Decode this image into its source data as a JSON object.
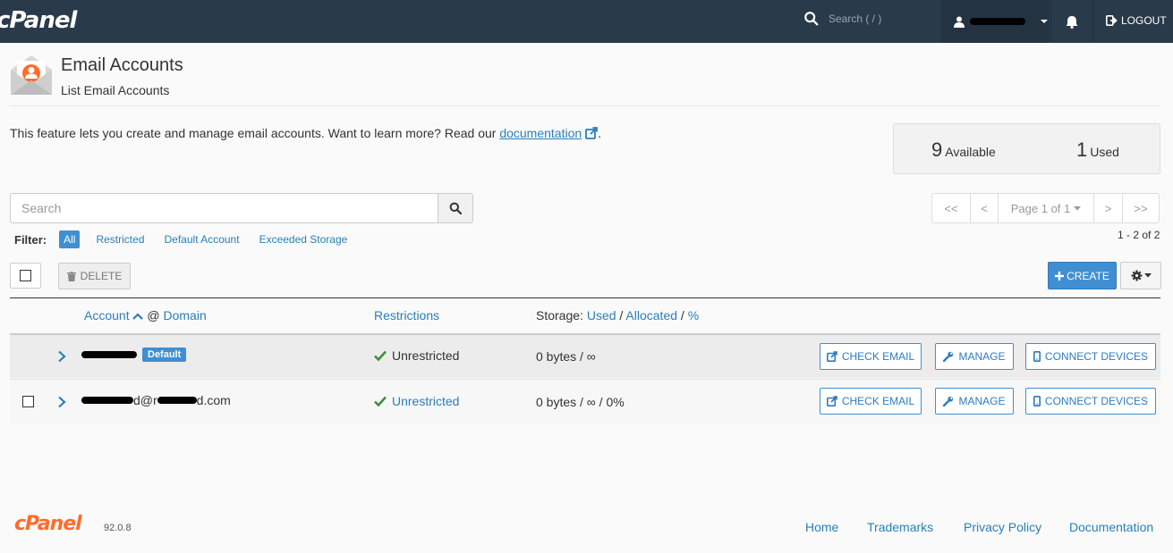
{
  "topbar": {
    "logo": "cPanel",
    "search_placeholder": "Search ( / )",
    "logout_label": "LOGOUT"
  },
  "header": {
    "title": "Email Accounts",
    "subtitle": "List Email Accounts"
  },
  "intro": {
    "text": "This feature lets you create and manage email accounts. Want to learn more? Read our ",
    "link": "documentation",
    "end": "."
  },
  "stats": {
    "available_num": "9",
    "available_label": "Available",
    "used_num": "1",
    "used_label": "Used"
  },
  "search": {
    "placeholder": "Search"
  },
  "filter": {
    "label": "Filter:",
    "items": [
      "All",
      "Restricted",
      "Default Account",
      "Exceeded Storage"
    ]
  },
  "pager": {
    "first": "<<",
    "prev": "<",
    "page": "Page 1 of 1",
    "next": ">",
    "last": ">>",
    "range": "1 - 2 of 2"
  },
  "toolbar": {
    "delete_label": "DELETE",
    "create_label": "CREATE"
  },
  "table": {
    "col_account": "Account",
    "col_at": "@",
    "col_domain": "Domain",
    "col_restrictions": "Restrictions",
    "col_storage": "Storage:",
    "col_used": "Used",
    "col_sep": "/",
    "col_allocated": "Allocated",
    "col_pct": "%",
    "rows": [
      {
        "account_suffix": "",
        "badge": "Default",
        "restriction": "Unrestricted",
        "storage": "0 bytes / ∞"
      },
      {
        "account_mid": "d@r",
        "account_suffix": "d.com",
        "badge": "",
        "restriction": "Unrestricted",
        "storage": "0 bytes / ∞ / 0%"
      }
    ],
    "btn_check": "CHECK EMAIL",
    "btn_manage": "MANAGE",
    "btn_connect": "CONNECT DEVICES"
  },
  "footer": {
    "logo": "cPanel",
    "version": "92.0.8",
    "links": [
      "Home",
      "Trademarks",
      "Privacy Policy",
      "Documentation"
    ]
  },
  "colors": {
    "topbar": "#293a4a",
    "accent": "#3f8fd2",
    "link": "#2980b9",
    "footer_logo": "#ff6c2c",
    "check": "#3c8f3c"
  }
}
